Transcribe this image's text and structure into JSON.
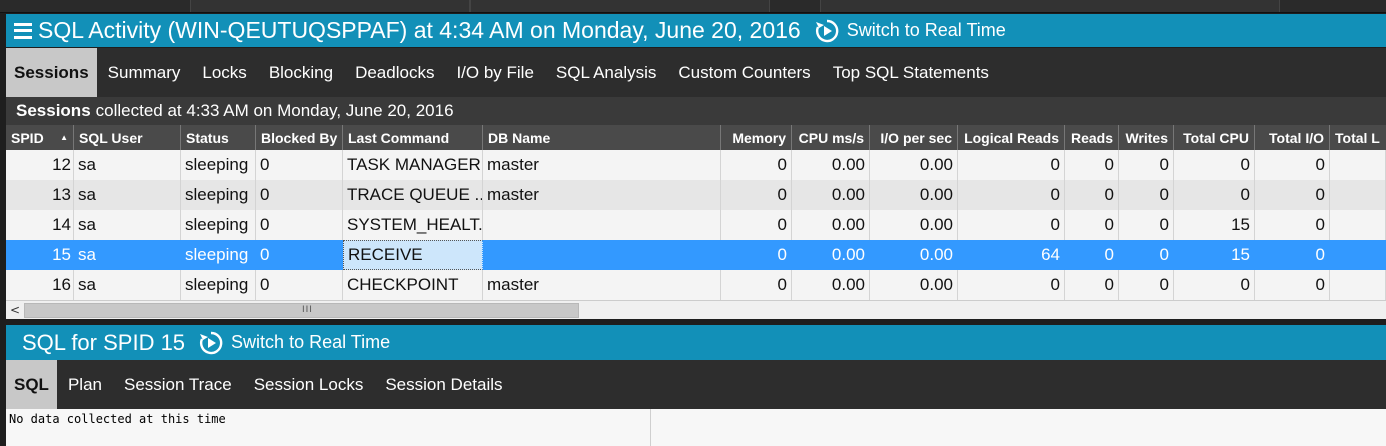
{
  "header": {
    "title": "SQL Activity (WIN-QEUTUQSPPAF) at 4:34 AM on Monday, June 20, 2016",
    "switch_label": "Switch to Real Time"
  },
  "tabs": [
    {
      "label": "Sessions",
      "active": true
    },
    {
      "label": "Summary",
      "active": false
    },
    {
      "label": "Locks",
      "active": false
    },
    {
      "label": "Blocking",
      "active": false
    },
    {
      "label": "Deadlocks",
      "active": false
    },
    {
      "label": "I/O by File",
      "active": false
    },
    {
      "label": "SQL Analysis",
      "active": false
    },
    {
      "label": "Custom Counters",
      "active": false
    },
    {
      "label": "Top SQL Statements",
      "active": false
    }
  ],
  "collected": {
    "label": "Sessions",
    "text": "collected at 4:33 AM on Monday, June 20, 2016"
  },
  "grid": {
    "columns": [
      "SPID",
      "SQL User",
      "Status",
      "Blocked By",
      "Last Command",
      "DB Name",
      "Memory",
      "CPU ms/s",
      "I/O per sec",
      "Logical Reads",
      "Reads",
      "Writes",
      "Total CPU",
      "Total I/O",
      "Total L"
    ],
    "rows": [
      [
        "12",
        "sa",
        "sleeping",
        "0",
        "TASK MANAGER",
        "master",
        "0",
        "0.00",
        "0.00",
        "0",
        "0",
        "0",
        "0",
        "0",
        ""
      ],
      [
        "13",
        "sa",
        "sleeping",
        "0",
        "TRACE QUEUE ...",
        "master",
        "0",
        "0.00",
        "0.00",
        "0",
        "0",
        "0",
        "0",
        "0",
        ""
      ],
      [
        "14",
        "sa",
        "sleeping",
        "0",
        "SYSTEM_HEALT...",
        "",
        "0",
        "0.00",
        "0.00",
        "0",
        "0",
        "0",
        "15",
        "0",
        ""
      ],
      [
        "15",
        "sa",
        "sleeping",
        "0",
        "RECEIVE",
        "",
        "0",
        "0.00",
        "0.00",
        "64",
        "0",
        "0",
        "15",
        "0",
        ""
      ],
      [
        "16",
        "sa",
        "sleeping",
        "0",
        "CHECKPOINT",
        "master",
        "0",
        "0.00",
        "0.00",
        "0",
        "0",
        "0",
        "0",
        "0",
        ""
      ]
    ],
    "selected_row": 3
  },
  "sql_panel": {
    "title": "SQL for SPID 15",
    "switch_label": "Switch to Real Time",
    "tabs": [
      {
        "label": "SQL",
        "active": true
      },
      {
        "label": "Plan",
        "active": false
      },
      {
        "label": "Session Trace",
        "active": false
      },
      {
        "label": "Session Locks",
        "active": false
      },
      {
        "label": "Session Details",
        "active": false
      }
    ],
    "content": "No data collected at this time"
  },
  "colors": {
    "header_bg": "#1290b8",
    "tabbar_bg": "#2d2d2d",
    "selected_row": "#3399ff"
  }
}
